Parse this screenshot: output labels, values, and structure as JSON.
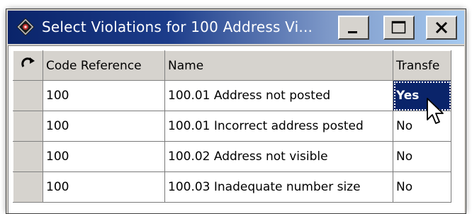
{
  "window": {
    "title": "Select Violations for 100  Address Vi...",
    "buttons": {
      "minimize": "minimize",
      "maximize": "maximize",
      "close": "close"
    }
  },
  "grid": {
    "columns": [
      "Code Reference",
      "Name",
      "Transfe"
    ],
    "rows": [
      {
        "code": "100",
        "name": "100.01  Address not posted",
        "transfer": "Yes"
      },
      {
        "code": "100",
        "name": "100.01  Incorrect address posted",
        "transfer": "No"
      },
      {
        "code": "100",
        "name": "100.02  Address not visible",
        "transfer": "No"
      },
      {
        "code": "100",
        "name": "100.03  Inadequate number size",
        "transfer": "No"
      }
    ]
  },
  "colors": {
    "titlebar_start": "#0a246a",
    "titlebar_end": "#a6caf0",
    "selection": "#0a246a",
    "face": "#d6d3ce"
  },
  "icons": [
    "app-icon",
    "refresh-icon",
    "minimize-icon",
    "maximize-icon",
    "close-icon",
    "mouse-cursor-icon"
  ]
}
